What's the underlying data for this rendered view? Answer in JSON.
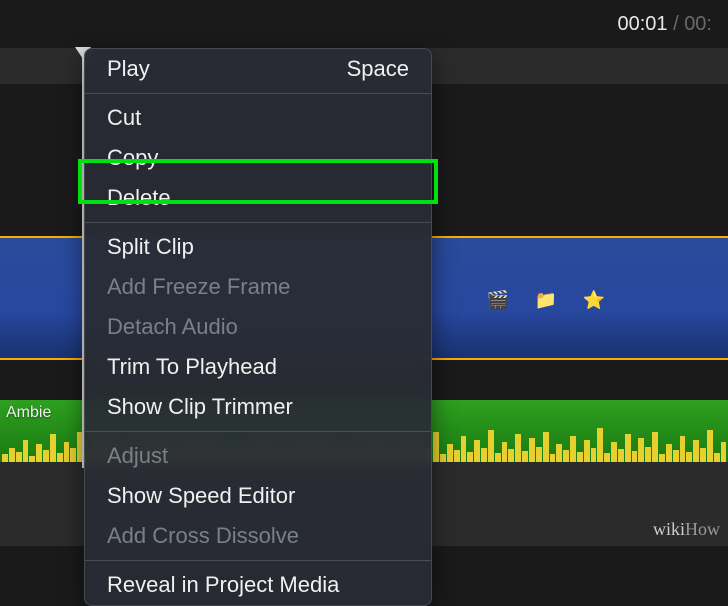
{
  "timecode": {
    "current": "00:01",
    "separator": " / ",
    "total": "00:"
  },
  "audio": {
    "label": "Ambie"
  },
  "menu": {
    "play": {
      "label": "Play",
      "shortcut": "Space"
    },
    "cut": "Cut",
    "copy": "Copy",
    "delete": "Delete",
    "split_clip": "Split Clip",
    "add_freeze_frame": "Add Freeze Frame",
    "detach_audio": "Detach Audio",
    "trim_to_playhead": "Trim To Playhead",
    "show_clip_trimmer": "Show Clip Trimmer",
    "adjust": "Adjust",
    "show_speed_editor": "Show Speed Editor",
    "add_cross_dissolve": "Add Cross Dissolve",
    "reveal_in_project_media": "Reveal in Project Media"
  },
  "watermark": {
    "wiki": "wiki",
    "how": "How"
  },
  "waveform_heights": [
    8,
    14,
    10,
    22,
    6,
    18,
    12,
    28,
    9,
    20,
    14,
    30,
    10,
    24,
    16,
    32,
    8,
    18,
    12,
    26,
    10,
    22,
    14,
    34,
    9,
    20,
    13,
    28,
    11,
    24,
    15,
    30,
    8,
    18,
    12,
    26,
    10,
    22,
    14,
    32,
    9,
    20,
    13,
    28,
    11,
    24,
    15,
    30,
    8,
    18,
    12,
    26,
    10,
    22,
    14,
    34,
    9,
    20,
    13,
    28,
    11,
    24,
    15,
    30,
    8,
    18,
    12,
    26,
    10,
    22,
    14,
    32,
    9,
    20,
    13,
    28,
    11,
    24,
    15,
    30,
    8,
    18,
    12,
    26,
    10,
    22,
    14,
    34,
    9,
    20,
    13,
    28,
    11,
    24,
    15,
    30,
    8,
    18,
    12,
    26,
    10,
    22,
    14,
    32,
    9,
    20
  ]
}
